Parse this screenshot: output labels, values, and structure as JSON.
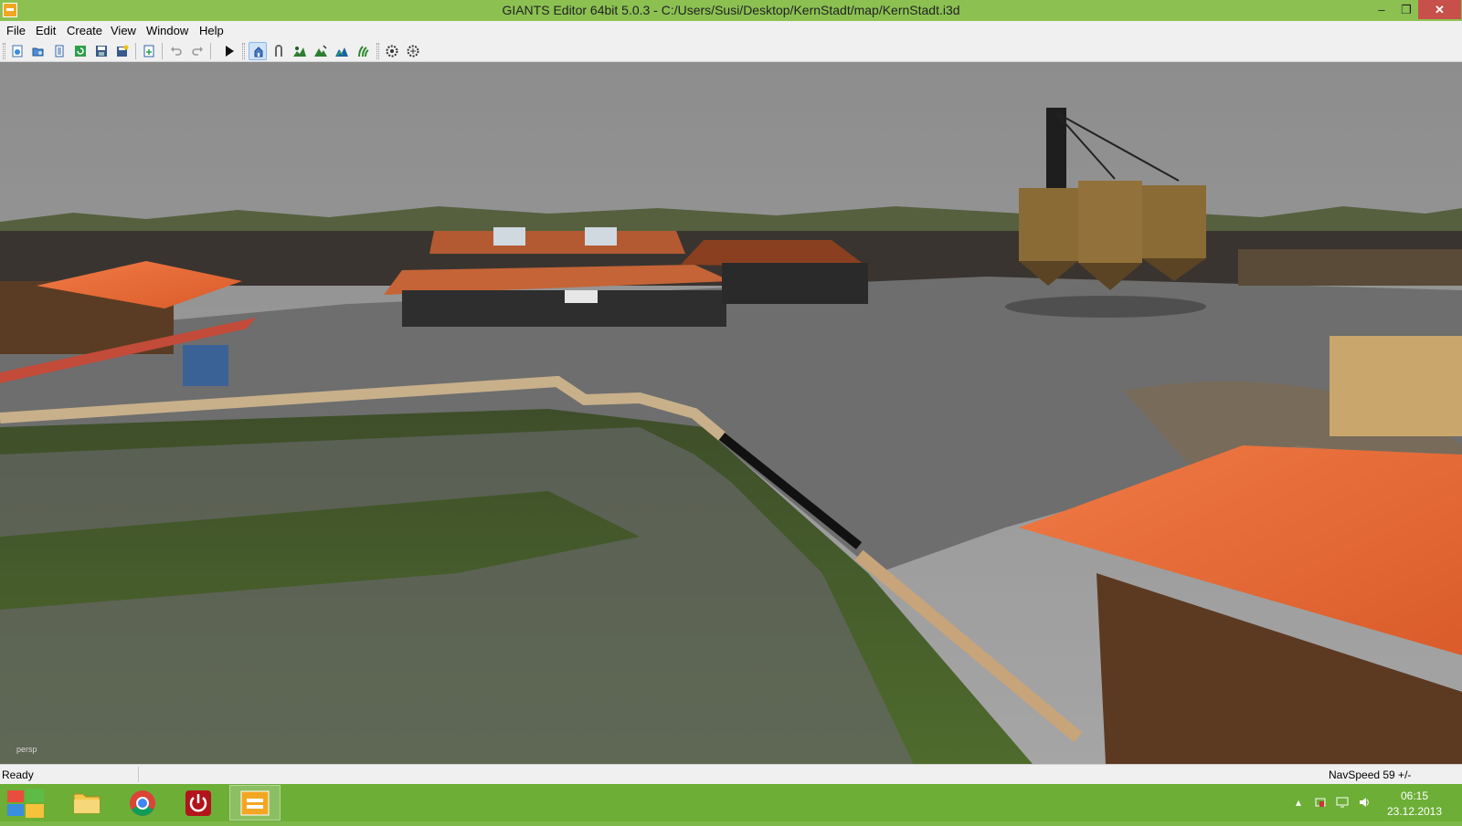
{
  "window": {
    "title": "GIANTS Editor 64bit 5.0.3 - C:/Users/Susi/Desktop/KernStadt/map/KernStadt.i3d",
    "minimize_glyph": "–",
    "maximize_glyph": "❐",
    "close_glyph": "✕"
  },
  "menu": {
    "items": [
      "File",
      "Edit",
      "Create",
      "View",
      "Window",
      "Help"
    ]
  },
  "toolbar": {
    "buttons": [
      {
        "icon": "new-scene-icon"
      },
      {
        "icon": "open-icon"
      },
      {
        "icon": "document-icon"
      },
      {
        "icon": "reload-icon"
      },
      {
        "icon": "save-icon"
      },
      {
        "icon": "save-all-icon"
      },
      {
        "icon": "import-icon"
      },
      {
        "icon": "undo-icon"
      },
      {
        "icon": "redo-icon"
      },
      {
        "icon": "play-icon"
      },
      {
        "icon": "select-mode-icon",
        "active": true
      },
      {
        "icon": "move-mode-icon"
      },
      {
        "icon": "terrain-paint-icon"
      },
      {
        "icon": "terrain-sculpt-icon"
      },
      {
        "icon": "terrain-texture-icon"
      },
      {
        "icon": "foliage-paint-icon"
      },
      {
        "icon": "gizmo-settings-icon"
      },
      {
        "icon": "gizmo-snap-icon"
      }
    ]
  },
  "viewport": {
    "camera_label": "persp"
  },
  "status": {
    "text": "Ready",
    "navspeed": "NavSpeed 59 +/-"
  },
  "taskbar": {
    "apps": [
      {
        "name": "file-explorer-icon"
      },
      {
        "name": "chrome-icon"
      },
      {
        "name": "power-app-icon"
      },
      {
        "name": "giants-editor-icon",
        "active": true
      }
    ],
    "tray": {
      "icons": [
        "show-hidden-icons-icon",
        "network-adapter-icon",
        "network-icon",
        "volume-icon"
      ],
      "time": "06:15",
      "date": "23.12.2013"
    }
  },
  "colors": {
    "titlebar": "#8cc152",
    "taskbar": "#6cae36",
    "close_button": "#c7504a",
    "chrome_bg": "#f0f0f0"
  }
}
